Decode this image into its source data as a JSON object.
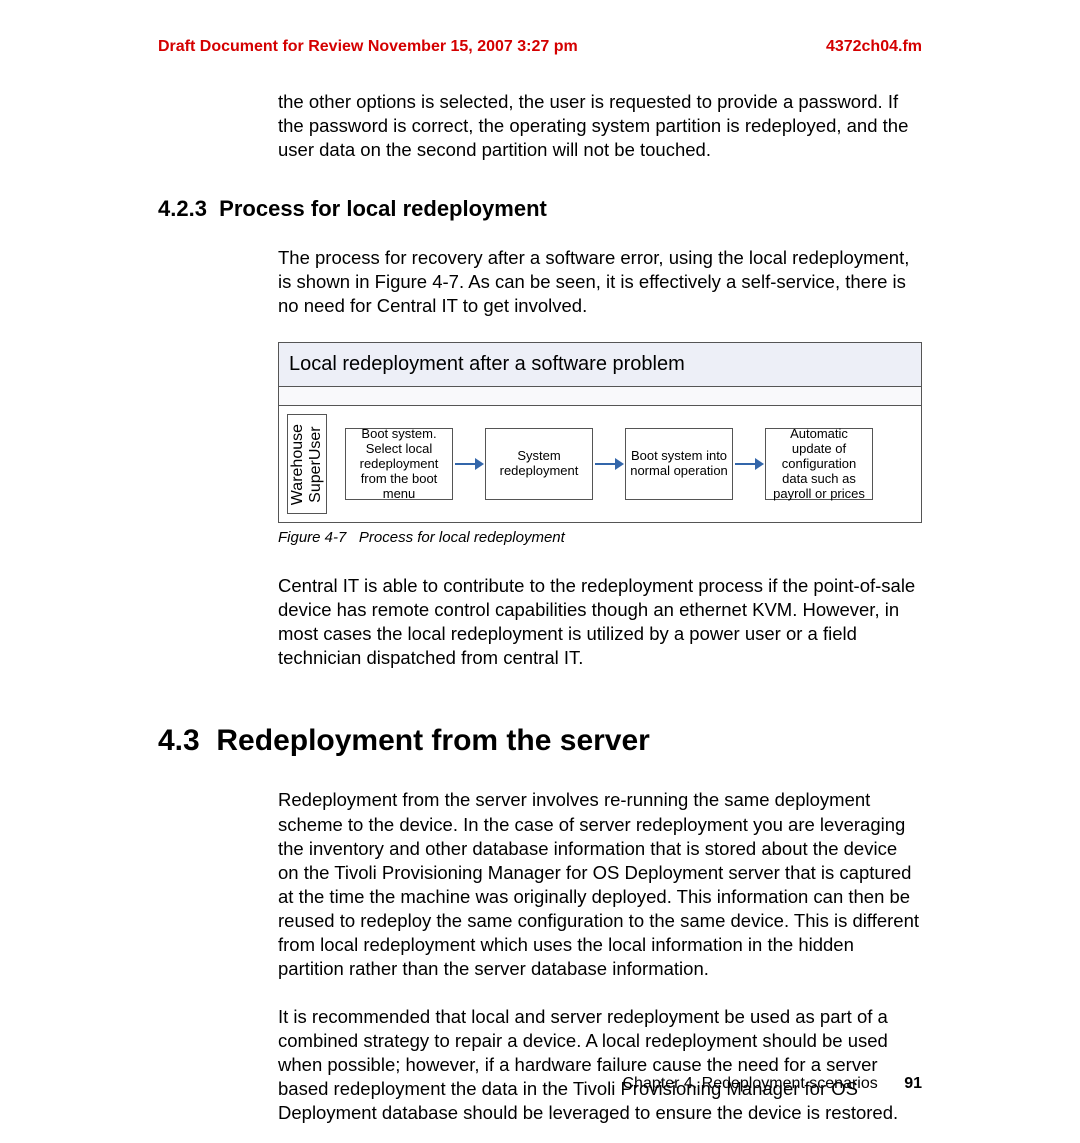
{
  "header": {
    "draft_notice": "Draft Document for Review November 15, 2007 3:27 pm",
    "filename": "4372ch04.fm"
  },
  "paragraphs": {
    "intro_continued": "the other options is selected, the user is requested to provide a password. If the password is correct, the operating system partition is redeployed, and the user data on the second partition will not be touched.",
    "process_intro": "The process for recovery after a software error, using the local redeployment, is shown in Figure 4-7. As can be seen, it is effectively a self-service, there is no need for Central IT to get involved.",
    "after_figure": "Central IT is able to contribute to the redeployment process if the point-of-sale device has remote control capabilities though an ethernet KVM. However, in most cases the local redeployment is utilized by a power user or a field technician dispatched from central IT.",
    "server_p1": "Redeployment from the server involves re-running the same deployment scheme to the device. In the case of server redeployment you are leveraging the inventory and other database information that is stored about the device on the Tivoli Provisioning Manager for OS Deployment server that is captured at the time the machine was originally deployed. This information can then be reused to redeploy the same configuration to the same device. This is different from local redeployment which uses the local information in the hidden partition rather than the server database information.",
    "server_p2": "It is recommended that local and server redeployment be used as part of a combined strategy to repair a device. A local redeployment should be used when possible; however, if a hardware failure cause the need for a server based redeployment the data in the Tivoli Provisioning Manager for OS Deployment database should be leveraged to ensure the device is restored."
  },
  "headings": {
    "h3_number": "4.2.3",
    "h3_text": "Process for local redeployment",
    "h2_number": "4.3",
    "h2_text": "Redeployment from the server"
  },
  "figure": {
    "title": "Local redeployment after a software problem",
    "swimlane": "Warehouse\nSuperUser",
    "steps": [
      "Boot system. Select local redeployment from the boot menu",
      "System redeployment",
      "Boot system into normal operation",
      "Automatic update of configuration data such as payroll or prices"
    ],
    "caption_label": "Figure 4-7",
    "caption_text": "Process for local redeployment"
  },
  "footer": {
    "chapter": "Chapter 4. Redeployment scenarios",
    "page": "91"
  }
}
